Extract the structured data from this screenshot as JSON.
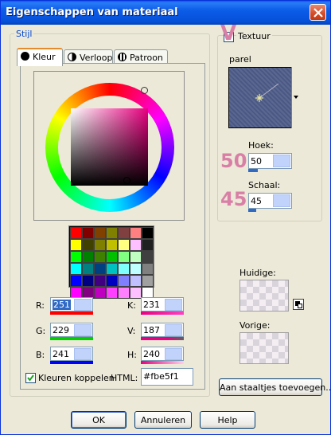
{
  "window": {
    "title": "Eigenschappen van materiaal"
  },
  "stijl": {
    "group_label": "Stijl",
    "tabs": [
      {
        "label": "Kleur",
        "icon": "circle-icon"
      },
      {
        "label": "Verloop",
        "icon": "gradient-half-icon"
      },
      {
        "label": "Patroon",
        "icon": "pattern-icon"
      }
    ],
    "palette": [
      "#ff0000",
      "#800000",
      "#804000",
      "#808000",
      "#804040",
      "#ff8080",
      "#000000",
      "#ffff00",
      "#404000",
      "#808000",
      "#c0c000",
      "#ffff80",
      "#ffc0ff",
      "#202020",
      "#00ff00",
      "#008000",
      "#408000",
      "#00c000",
      "#80ff80",
      "#c0ffc0",
      "#404040",
      "#00ffff",
      "#008080",
      "#004080",
      "#00c0c0",
      "#80ffff",
      "#c0ffff",
      "#808080",
      "#0000ff",
      "#000080",
      "#400080",
      "#0000c0",
      "#8080ff",
      "#c0c0ff",
      "#a0a0a0",
      "#ff00ff",
      "#800080",
      "#c000c0",
      "#ff40ff",
      "#ff80ff",
      "#ffc0ff",
      "#ffffff"
    ],
    "fields": {
      "r": {
        "label": "R:",
        "value": "251"
      },
      "g": {
        "label": "G:",
        "value": "229"
      },
      "b": {
        "label": "B:",
        "value": "241"
      },
      "k": {
        "label": "K:",
        "value": "231"
      },
      "v": {
        "label": "V:",
        "value": "187"
      },
      "h": {
        "label": "H:",
        "value": "240"
      }
    },
    "link_colors": {
      "label": "Kleuren koppelen",
      "checked": true
    },
    "html": {
      "label": "HTML:",
      "value": "#fbe5f1"
    }
  },
  "textuur": {
    "label": "Textuur",
    "checked": true,
    "annotation_v": "V",
    "name": "parel",
    "hoek": {
      "label": "Hoek:",
      "value": "50",
      "annotation": "50"
    },
    "schaal": {
      "label": "Schaal:",
      "value": "45",
      "annotation": "45"
    }
  },
  "preview": {
    "current_label": "Huidige:",
    "previous_label": "Vorige:"
  },
  "buttons": {
    "add_swatches": "Aan staaltjes toevoegen...",
    "ok": "OK",
    "cancel": "Annuleren",
    "help": "Help"
  },
  "colors": {
    "accent": "#e7007f",
    "annotation": "#d97fa6",
    "title_blue": "#0650d8"
  }
}
